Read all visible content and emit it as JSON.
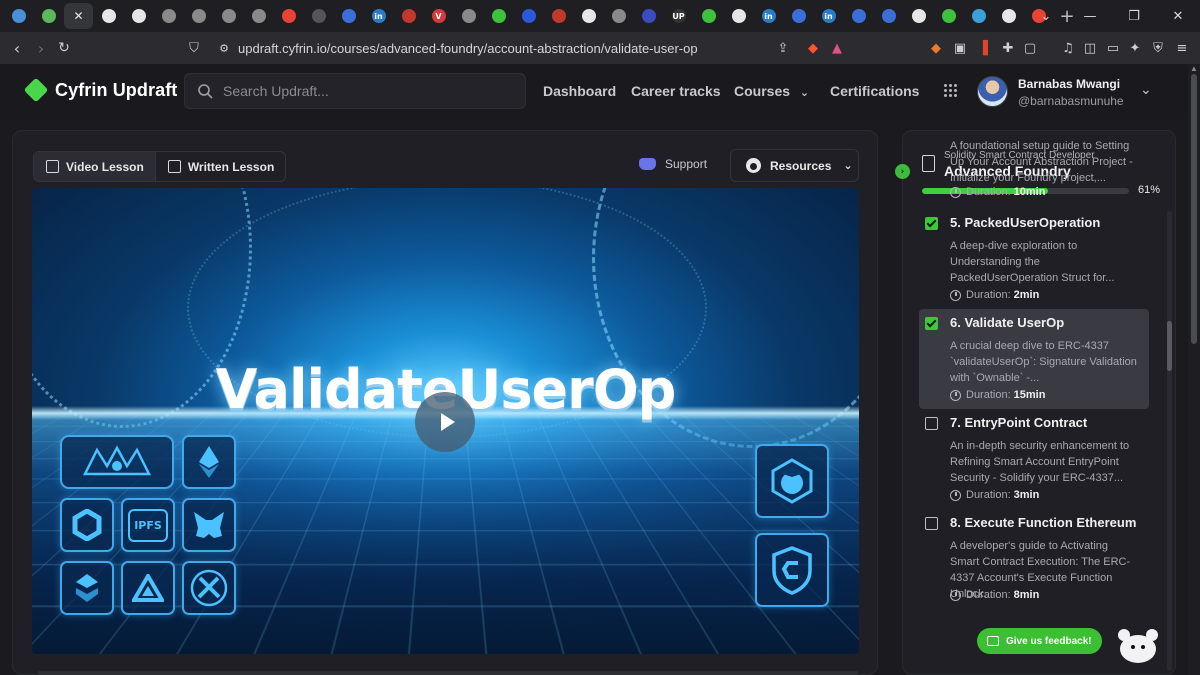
{
  "browser": {
    "url": "updraft.cyfrin.io/courses/advanced-foundry/account-abstraction/validate-user-op",
    "tabs": [
      {
        "icon": "tab-icon-1",
        "color": "#4a90d9",
        "glyph": ""
      },
      {
        "icon": "tab-icon-2",
        "color": "#5cb85c",
        "glyph": ""
      },
      {
        "icon": "close-tab-icon",
        "color": "",
        "glyph": "✕"
      },
      {
        "icon": "github-icon",
        "color": "#e6e6e6",
        "glyph": ""
      },
      {
        "icon": "openai-icon",
        "color": "#e6e6e6",
        "glyph": ""
      },
      {
        "icon": "tab-icon-6",
        "color": "#8a8a8a",
        "glyph": ""
      },
      {
        "icon": "tab-icon-7",
        "color": "#8a8a8a",
        "glyph": ""
      },
      {
        "icon": "tab-icon-8",
        "color": "#8a8a8a",
        "glyph": ""
      },
      {
        "icon": "tab-icon-9",
        "color": "#8a8a8a",
        "glyph": ""
      },
      {
        "icon": "google-icon",
        "color": "#ea4335",
        "glyph": ""
      },
      {
        "icon": "tab-icon-11",
        "color": "#555",
        "glyph": ""
      },
      {
        "icon": "tab-icon-12",
        "color": "#3b6fd8",
        "glyph": ""
      },
      {
        "icon": "linkedin-icon",
        "color": "#2a7cc4",
        "glyph": "in"
      },
      {
        "icon": "tab-icon-14",
        "color": "#c0392b",
        "glyph": ""
      },
      {
        "icon": "tab-icon-15",
        "color": "#d63b3b",
        "glyph": "V"
      },
      {
        "icon": "tab-icon-16",
        "color": "#8a8a8a",
        "glyph": ""
      },
      {
        "icon": "tab-icon-17",
        "color": "#3ec23e",
        "glyph": ""
      },
      {
        "icon": "chainlink-icon",
        "color": "#2a5ada",
        "glyph": ""
      },
      {
        "icon": "tab-icon-19",
        "color": "#c0392b",
        "glyph": ""
      },
      {
        "icon": "tab-icon-20",
        "color": "#e6e6e6",
        "glyph": ""
      },
      {
        "icon": "tab-icon-21",
        "color": "#8a8a8a",
        "glyph": ""
      },
      {
        "icon": "ethereum-icon",
        "color": "#3b4cc0",
        "glyph": ""
      },
      {
        "icon": "tab-icon-23",
        "color": "#333",
        "glyph": "UP"
      },
      {
        "icon": "tab-icon-24",
        "color": "#3ec23e",
        "glyph": ""
      },
      {
        "icon": "github-icon",
        "color": "#e6e6e6",
        "glyph": ""
      },
      {
        "icon": "linkedin-icon",
        "color": "#2a7cc4",
        "glyph": "in"
      },
      {
        "icon": "tab-icon-27",
        "color": "#3b6fd8",
        "glyph": ""
      },
      {
        "icon": "linkedin-icon",
        "color": "#2a7cc4",
        "glyph": "in"
      },
      {
        "icon": "tab-icon-29",
        "color": "#3b6fd8",
        "glyph": ""
      },
      {
        "icon": "tab-icon-30",
        "color": "#3b6fd8",
        "glyph": ""
      },
      {
        "icon": "github-icon",
        "color": "#e6e6e6",
        "glyph": ""
      },
      {
        "icon": "tab-icon-32",
        "color": "#3ec23e",
        "glyph": ""
      },
      {
        "icon": "tab-icon-33",
        "color": "#3b9fd8",
        "glyph": ""
      },
      {
        "icon": "github-icon",
        "color": "#e6e6e6",
        "glyph": ""
      },
      {
        "icon": "google-icon",
        "color": "#ea4335",
        "glyph": ""
      }
    ]
  },
  "site": {
    "logo": "Cyfrin Updraft",
    "search_placeholder": "Search Updraft...",
    "nav": {
      "dashboard": "Dashboard",
      "career_tracks": "Career tracks",
      "courses": "Courses",
      "certifications": "Certifications"
    },
    "user": {
      "name": "Barnabas Mwangi",
      "handle": "@barnabasmunuhe"
    }
  },
  "lesson": {
    "tabs": {
      "video": "Video Lesson",
      "written": "Written Lesson"
    },
    "support": "Support",
    "resources": "Resources",
    "video_title": "ValidateUserOp",
    "tile_labels": {
      "ipfs": "IPFS"
    }
  },
  "sidebar": {
    "track": "Solidity Smart Contract Developer",
    "course": "Advanced Foundry",
    "progress_fraction": 0.61,
    "progress_label": "61%",
    "duration_label": "Duration:",
    "items": [
      {
        "title": "",
        "desc": "A foundational setup guide to Setting Up Your Account Abstraction Project - Initialize your Foundry project,...",
        "duration": "10min",
        "checked": null
      },
      {
        "title": "5. PackedUserOperation",
        "desc": "A deep-dive exploration to Understanding the PackedUserOperation Struct for...",
        "duration": "2min",
        "checked": true
      },
      {
        "title": "6. Validate UserOp",
        "desc": "A crucial deep dive to ERC-4337 `validateUserOp`: Signature Validation with `Ownable` -...",
        "duration": "15min",
        "checked": true
      },
      {
        "title": "7. EntryPoint Contract",
        "desc": "An in-depth security enhancement to Refining Smart Account EntryPoint Security - Solidify your ERC-4337...",
        "duration": "3min",
        "checked": false
      },
      {
        "title": "8. Execute Function Ethereum",
        "desc": "A developer's guide to Activating Smart Contract Execution: The ERC-4337 Account's Execute Function Unlock...",
        "duration": "8min",
        "checked": false
      }
    ]
  },
  "feedback": "Give us feedback!",
  "colors": {
    "accent": "#3ec73e",
    "background": "#1b1b1f",
    "panel": "#1f1f25"
  }
}
